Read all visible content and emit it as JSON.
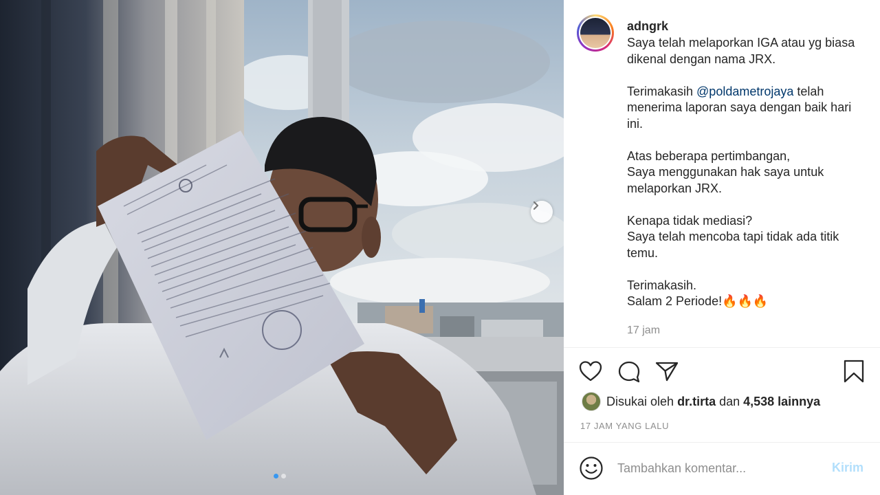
{
  "post": {
    "username": "adngrk",
    "caption_parts": {
      "p1": "Saya telah melaporkan IGA atau yg biasa dikenal dengan nama JRX.",
      "p2_before": "Terimakasih ",
      "p2_mention": "@poldametrojaya",
      "p2_after": " telah menerima laporan saya dengan baik hari ini.",
      "p3": "Atas beberapa pertimbangan,\nSaya menggunakan hak saya untuk melaporkan JRX.",
      "p4": "Kenapa tidak mediasi?\nSaya telah mencoba tapi tidak ada titik temu.",
      "p5": "Terimakasih.\nSalam 2 Periode!🔥🔥🔥"
    },
    "caption_time": "17 jam",
    "likes": {
      "prefix": "Disukai oleh ",
      "user": "dr.tirta",
      "middle": " dan ",
      "count": "4,538 lainnya"
    },
    "date_caps": "17 JAM YANG LALU"
  },
  "comment": {
    "placeholder": "Tambahkan komentar...",
    "post_label": "Kirim"
  },
  "carousel": {
    "total_slides": 2,
    "active_slide": 1
  },
  "icons": {
    "like": "heart-icon",
    "comment": "comment-bubble-icon",
    "share": "paper-plane-icon",
    "save": "bookmark-icon",
    "next": "chevron-right-icon",
    "emoji": "smiley-icon"
  },
  "colors": {
    "mention": "#00376b",
    "active_dot": "#3897f0",
    "post_button_disabled": "#b2dffc",
    "muted": "#8e8e8e"
  }
}
